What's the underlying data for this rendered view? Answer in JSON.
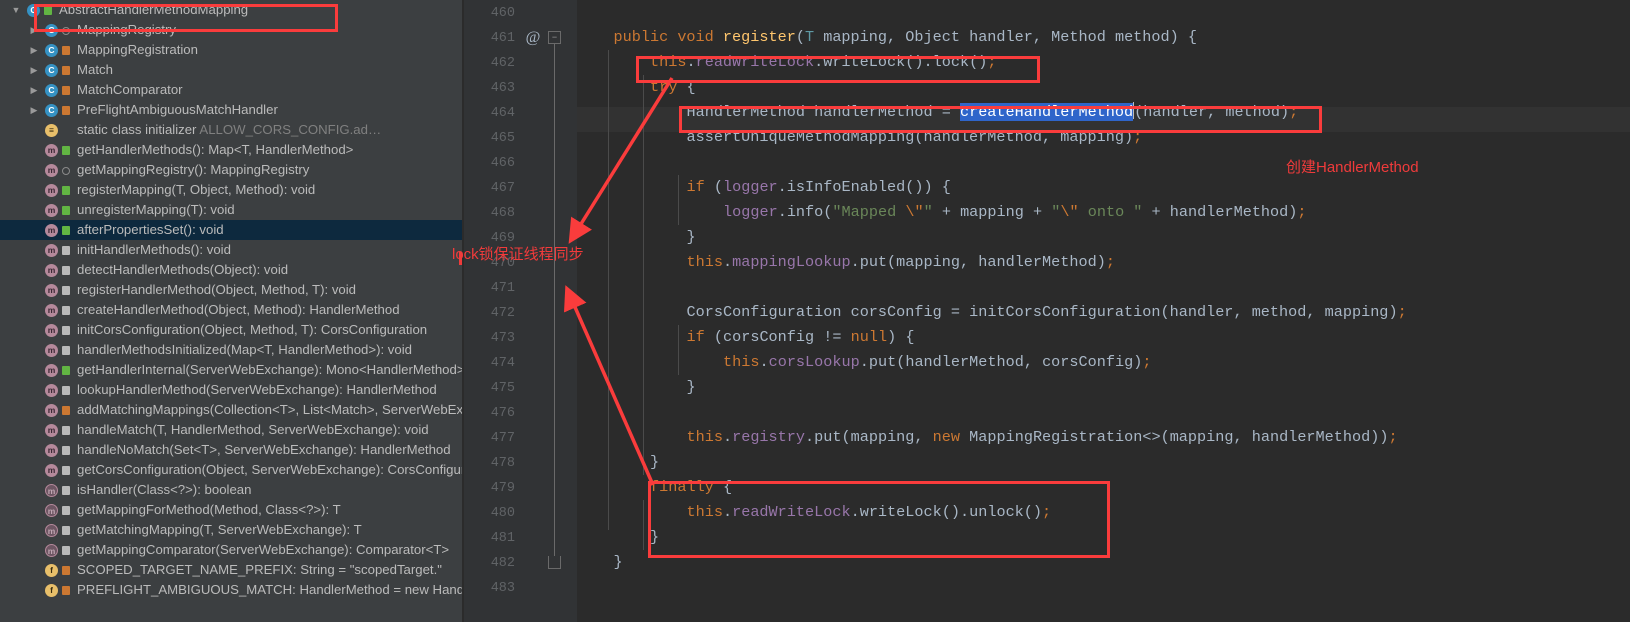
{
  "structure_panel": {
    "items": [
      {
        "indent": 0,
        "twisty": "▼",
        "icon": "class-icon",
        "icon_kind": "class",
        "modifier": "public-marker",
        "label": "AbstractHandlerMethodMapping",
        "sub": "",
        "highlighted_box": true,
        "selected": false
      },
      {
        "indent": 1,
        "twisty": "▶",
        "icon": "class-icon",
        "icon_kind": "class",
        "modifier": "package-private-marker",
        "label": "MappingRegistry",
        "sub": "",
        "selected": false
      },
      {
        "indent": 1,
        "twisty": "▶",
        "icon": "class-icon",
        "icon_kind": "class",
        "modifier": "private-lock",
        "label": "MappingRegistration",
        "sub": "",
        "selected": false
      },
      {
        "indent": 1,
        "twisty": "▶",
        "icon": "class-icon",
        "icon_kind": "class",
        "modifier": "private-lock",
        "label": "Match",
        "sub": "",
        "selected": false
      },
      {
        "indent": 1,
        "twisty": "▶",
        "icon": "class-icon",
        "icon_kind": "class",
        "modifier": "private-lock",
        "label": "MatchComparator",
        "sub": "",
        "selected": false
      },
      {
        "indent": 1,
        "twisty": "▶",
        "icon": "class-icon",
        "icon_kind": "class",
        "modifier": "private-lock",
        "label": "PreFlightAmbiguousMatchHandler",
        "sub": "",
        "selected": false
      },
      {
        "indent": 1,
        "twisty": "",
        "icon": "initializer-icon",
        "icon_kind": "init",
        "modifier": "",
        "label": "static class initializer",
        "sub": "ALLOW_CORS_CONFIG.ad…",
        "selected": false
      },
      {
        "indent": 1,
        "twisty": "",
        "icon": "method-icon",
        "icon_kind": "method",
        "modifier": "public-marker",
        "label": "getHandlerMethods(): Map<T, HandlerMethod>",
        "sub": "",
        "selected": false
      },
      {
        "indent": 1,
        "twisty": "",
        "icon": "method-icon",
        "icon_kind": "method",
        "modifier": "package-private-marker",
        "label": "getMappingRegistry(): MappingRegistry",
        "sub": "",
        "selected": false
      },
      {
        "indent": 1,
        "twisty": "",
        "icon": "method-icon",
        "icon_kind": "method",
        "modifier": "public-marker",
        "label": "registerMapping(T, Object, Method): void",
        "sub": "",
        "selected": false
      },
      {
        "indent": 1,
        "twisty": "",
        "icon": "method-icon",
        "icon_kind": "method",
        "modifier": "public-marker",
        "label": "unregisterMapping(T): void",
        "sub": "",
        "selected": false
      },
      {
        "indent": 1,
        "twisty": "",
        "icon": "method-icon",
        "icon_kind": "method",
        "modifier": "public-marker",
        "label": "afterPropertiesSet(): void",
        "sub": "",
        "selected": true
      },
      {
        "indent": 1,
        "twisty": "",
        "icon": "method-icon",
        "icon_kind": "method",
        "modifier": "protected-marker",
        "label": "initHandlerMethods(): void",
        "sub": "",
        "selected": false
      },
      {
        "indent": 1,
        "twisty": "",
        "icon": "method-icon",
        "icon_kind": "method",
        "modifier": "protected-marker",
        "label": "detectHandlerMethods(Object): void",
        "sub": "",
        "selected": false
      },
      {
        "indent": 1,
        "twisty": "",
        "icon": "method-icon",
        "icon_kind": "method",
        "modifier": "protected-marker",
        "label": "registerHandlerMethod(Object, Method, T): void",
        "sub": "",
        "selected": false
      },
      {
        "indent": 1,
        "twisty": "",
        "icon": "method-icon",
        "icon_kind": "method",
        "modifier": "protected-marker",
        "label": "createHandlerMethod(Object, Method): HandlerMethod",
        "sub": "",
        "selected": false
      },
      {
        "indent": 1,
        "twisty": "",
        "icon": "method-icon",
        "icon_kind": "method",
        "modifier": "protected-marker",
        "label": "initCorsConfiguration(Object, Method, T): CorsConfiguration",
        "sub": "",
        "selected": false
      },
      {
        "indent": 1,
        "twisty": "",
        "icon": "method-icon",
        "icon_kind": "method",
        "modifier": "protected-marker",
        "label": "handlerMethodsInitialized(Map<T, HandlerMethod>): void",
        "sub": "",
        "selected": false
      },
      {
        "indent": 1,
        "twisty": "",
        "icon": "method-icon",
        "icon_kind": "method",
        "modifier": "public-marker",
        "label": "getHandlerInternal(ServerWebExchange): Mono<HandlerMethod> ↑",
        "sub": "",
        "selected": false
      },
      {
        "indent": 1,
        "twisty": "",
        "icon": "method-icon",
        "icon_kind": "method",
        "modifier": "protected-marker",
        "label": "lookupHandlerMethod(ServerWebExchange): HandlerMethod",
        "sub": "",
        "selected": false
      },
      {
        "indent": 1,
        "twisty": "",
        "icon": "method-icon",
        "icon_kind": "method",
        "modifier": "private-lock",
        "label": "addMatchingMappings(Collection<T>, List<Match>, ServerWebExch",
        "sub": "",
        "selected": false
      },
      {
        "indent": 1,
        "twisty": "",
        "icon": "method-icon",
        "icon_kind": "method",
        "modifier": "protected-marker",
        "label": "handleMatch(T, HandlerMethod, ServerWebExchange): void",
        "sub": "",
        "selected": false
      },
      {
        "indent": 1,
        "twisty": "",
        "icon": "method-icon",
        "icon_kind": "method",
        "modifier": "protected-marker",
        "label": "handleNoMatch(Set<T>, ServerWebExchange): HandlerMethod",
        "sub": "",
        "selected": false
      },
      {
        "indent": 1,
        "twisty": "",
        "icon": "method-icon",
        "icon_kind": "method",
        "modifier": "protected-marker",
        "label": "getCorsConfiguration(Object, ServerWebExchange): CorsConfiguratio",
        "sub": "",
        "selected": false
      },
      {
        "indent": 1,
        "twisty": "",
        "icon": "abstract-method-icon",
        "icon_kind": "method-abs",
        "modifier": "protected-marker",
        "label": "isHandler(Class<?>): boolean",
        "sub": "",
        "selected": false
      },
      {
        "indent": 1,
        "twisty": "",
        "icon": "abstract-method-icon",
        "icon_kind": "method-abs",
        "modifier": "protected-marker",
        "label": "getMappingForMethod(Method, Class<?>): T",
        "sub": "",
        "selected": false
      },
      {
        "indent": 1,
        "twisty": "",
        "icon": "abstract-method-icon",
        "icon_kind": "method-abs",
        "modifier": "protected-marker",
        "label": "getMatchingMapping(T, ServerWebExchange): T",
        "sub": "",
        "selected": false
      },
      {
        "indent": 1,
        "twisty": "",
        "icon": "abstract-method-icon",
        "icon_kind": "method-abs",
        "modifier": "protected-marker",
        "label": "getMappingComparator(ServerWebExchange): Comparator<T>",
        "sub": "",
        "selected": false
      },
      {
        "indent": 1,
        "twisty": "",
        "icon": "field-icon",
        "icon_kind": "field",
        "modifier": "private-lock",
        "label": "SCOPED_TARGET_NAME_PREFIX: String = \"scopedTarget.\"",
        "sub": "",
        "selected": false
      },
      {
        "indent": 1,
        "twisty": "",
        "icon": "field-icon",
        "icon_kind": "field",
        "modifier": "private-lock",
        "label": "PREFLIGHT_AMBIGUOUS_MATCH: HandlerMethod = new HandlerM",
        "sub": "",
        "selected": false
      }
    ]
  },
  "editor": {
    "first_line_number": 460,
    "line_numbers": [
      460,
      461,
      462,
      463,
      464,
      465,
      466,
      467,
      468,
      469,
      470,
      471,
      472,
      473,
      474,
      475,
      476,
      477,
      478,
      479,
      480,
      481,
      482,
      483
    ],
    "gutter": {
      "override_icon": "@",
      "override_icon_line": 461,
      "fold_marker_line": 461,
      "fold_end_line": 482
    },
    "current_line": 464,
    "selection": {
      "text": "createHandlerMethod",
      "line": 464
    },
    "lines": [
      {
        "n": 460,
        "text": ""
      },
      {
        "n": 461,
        "text": "    public void register(T mapping, Object handler, Method method) {"
      },
      {
        "n": 462,
        "text": "        this.readWriteLock.writeLock().lock();"
      },
      {
        "n": 463,
        "text": "        try {"
      },
      {
        "n": 464,
        "text": "            HandlerMethod handlerMethod = createHandlerMethod(handler, method);"
      },
      {
        "n": 465,
        "text": "            assertUniqueMethodMapping(handlerMethod, mapping);"
      },
      {
        "n": 466,
        "text": ""
      },
      {
        "n": 467,
        "text": "            if (logger.isInfoEnabled()) {"
      },
      {
        "n": 468,
        "text": "                logger.info(\"Mapped \\\"\" + mapping + \"\\\" onto \" + handlerMethod);"
      },
      {
        "n": 469,
        "text": "            }"
      },
      {
        "n": 470,
        "text": "            this.mappingLookup.put(mapping, handlerMethod);"
      },
      {
        "n": 471,
        "text": ""
      },
      {
        "n": 472,
        "text": "            CorsConfiguration corsConfig = initCorsConfiguration(handler, method, mapping);"
      },
      {
        "n": 473,
        "text": "            if (corsConfig != null) {"
      },
      {
        "n": 474,
        "text": "                this.corsLookup.put(handlerMethod, corsConfig);"
      },
      {
        "n": 475,
        "text": "            }"
      },
      {
        "n": 476,
        "text": ""
      },
      {
        "n": 477,
        "text": "            this.registry.put(mapping, new MappingRegistration<>(mapping, handlerMethod));"
      },
      {
        "n": 478,
        "text": "        }"
      },
      {
        "n": 479,
        "text": "        finally {"
      },
      {
        "n": 480,
        "text": "            this.readWriteLock.writeLock().unlock();"
      },
      {
        "n": 481,
        "text": "        }"
      },
      {
        "n": 482,
        "text": "    }"
      },
      {
        "n": 483,
        "text": ""
      }
    ]
  },
  "annotations": {
    "accent_color": "#fa3c3c",
    "text_color": "#f03b3b",
    "labels": [
      {
        "id": "create-handler-method-note",
        "text": "创建HandlerMethod"
      },
      {
        "id": "lock-note",
        "text": "lock锁保证线程同步"
      }
    ],
    "boxes": [
      {
        "id": "class-name-box"
      },
      {
        "id": "write-lock-box"
      },
      {
        "id": "create-handler-method-box"
      },
      {
        "id": "finally-block-box"
      }
    ]
  }
}
